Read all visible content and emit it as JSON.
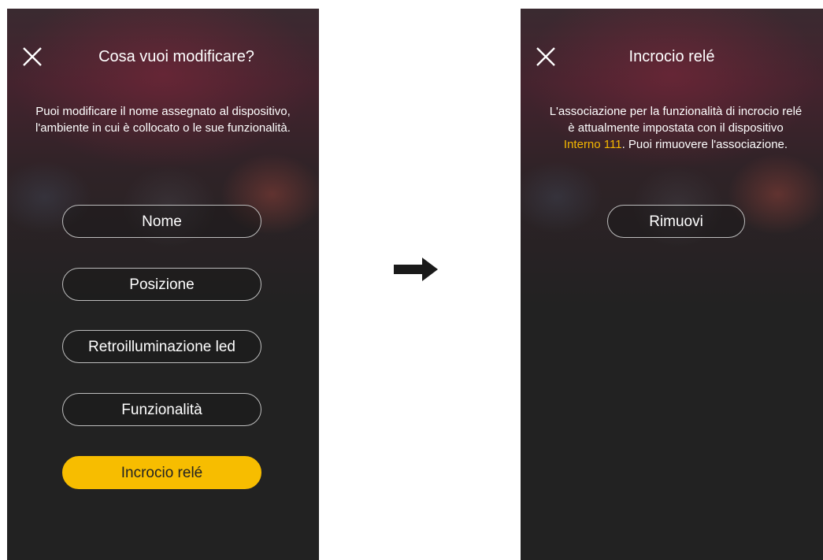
{
  "left_screen": {
    "title": "Cosa vuoi modificare?",
    "description": "Puoi modificare il nome assegnato al dispositivo, l'ambiente in cui è collocato o le sue funzionalità.",
    "buttons": [
      {
        "label": "Nome"
      },
      {
        "label": "Posizione"
      },
      {
        "label": "Retroilluminazione led"
      },
      {
        "label": "Funzionalità"
      },
      {
        "label": "Incrocio relé",
        "selected": true
      }
    ]
  },
  "right_screen": {
    "title": "Incrocio relé",
    "description_line1": "L'associazione per la funzionalità di incrocio relé",
    "description_line2": "è attualmente impostata con il dispositivo",
    "device_name": "Interno 111",
    "description_line3_rest": ". Puoi rimuovere l'associazione.",
    "remove_button": "Rimuovi"
  },
  "colors": {
    "accent": "#f7bd00",
    "background": "#222222",
    "highlight_text": "#f5b800"
  },
  "icons": {
    "close": "close-icon",
    "arrow": "arrow-right-icon"
  }
}
